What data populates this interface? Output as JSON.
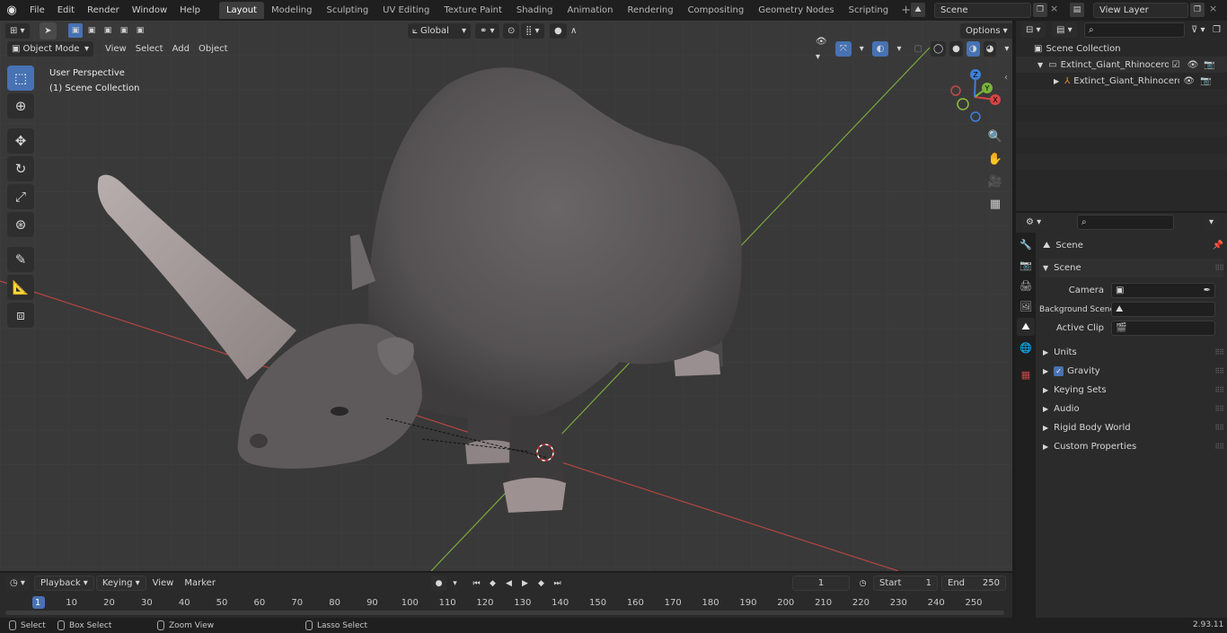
{
  "menu": [
    "File",
    "Edit",
    "Render",
    "Window",
    "Help"
  ],
  "workspaces": [
    {
      "label": "Layout",
      "active": true
    },
    {
      "label": "Modeling"
    },
    {
      "label": "Sculpting"
    },
    {
      "label": "UV Editing"
    },
    {
      "label": "Texture Paint"
    },
    {
      "label": "Shading"
    },
    {
      "label": "Animation"
    },
    {
      "label": "Rendering"
    },
    {
      "label": "Compositing"
    },
    {
      "label": "Geometry Nodes"
    },
    {
      "label": "Scripting"
    }
  ],
  "scene_field": "Scene",
  "view_layer_field": "View Layer",
  "viewport": {
    "mode": "Object Mode",
    "menus": [
      "View",
      "Select",
      "Add",
      "Object"
    ],
    "transform_orientation": "Global",
    "options_label": "Options",
    "overlay_line1": "User Perspective",
    "overlay_line2": "(1) Scene Collection",
    "gizmo_axes": {
      "x": "X",
      "y": "Y",
      "z": "Z"
    }
  },
  "outliner": {
    "root": "Scene Collection",
    "items": [
      {
        "label": "Extinct_Giant_Rhinoceros_Wa",
        "level": 1
      },
      {
        "label": "Extinct_Giant_Rhinoceros",
        "level": 2
      }
    ]
  },
  "properties": {
    "header": "Scene",
    "section": "Scene",
    "fields": [
      {
        "label": "Camera",
        "value": ""
      },
      {
        "label": "Background Scene",
        "value": ""
      },
      {
        "label": "Active Clip",
        "value": ""
      }
    ],
    "panels": [
      {
        "label": "Units",
        "checkbox": false
      },
      {
        "label": "Gravity",
        "checkbox": true
      },
      {
        "label": "Keying Sets",
        "checkbox": false
      },
      {
        "label": "Audio",
        "checkbox": false
      },
      {
        "label": "Rigid Body World",
        "checkbox": false
      },
      {
        "label": "Custom Properties",
        "checkbox": false
      }
    ]
  },
  "timeline": {
    "menus": [
      "Playback",
      "Keying",
      "View",
      "Marker"
    ],
    "current_frame": "1",
    "start_label": "Start",
    "start_value": "1",
    "end_label": "End",
    "end_value": "250",
    "ticks": [
      "1",
      "10",
      "20",
      "30",
      "40",
      "50",
      "60",
      "70",
      "80",
      "90",
      "100",
      "110",
      "120",
      "130",
      "140",
      "150",
      "160",
      "170",
      "180",
      "190",
      "200",
      "210",
      "220",
      "230",
      "240",
      "250"
    ]
  },
  "status": {
    "select": "Select",
    "box_select": "Box Select",
    "zoom_view": "Zoom View",
    "lasso_select": "Lasso Select",
    "version": "2.93.11"
  },
  "colors": {
    "accent": "#4772b3",
    "x_axis": "#d64545",
    "y_axis": "#7ab33a",
    "z_axis": "#3f7fd8"
  }
}
